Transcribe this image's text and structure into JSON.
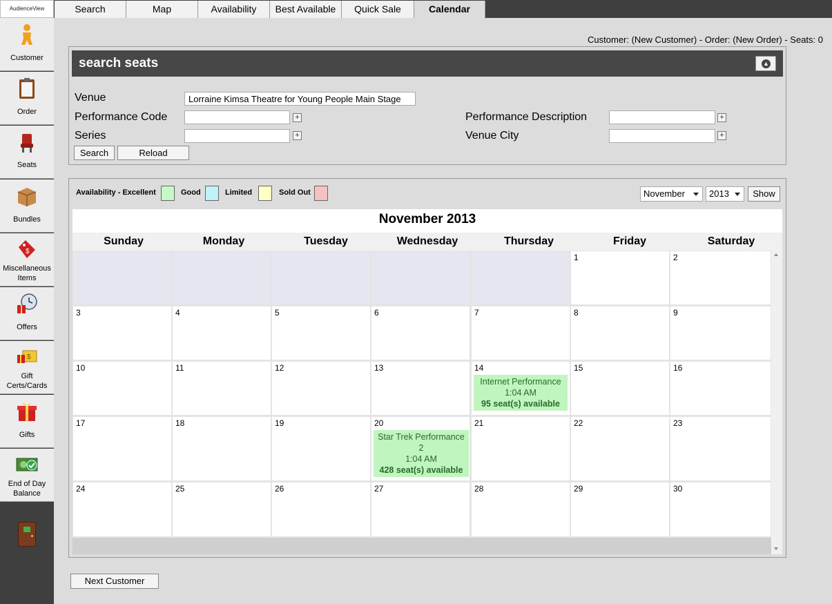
{
  "app": {
    "logo_text": "AudienceView"
  },
  "sidebar": {
    "items": [
      {
        "label": "Customer",
        "icon": "person-icon"
      },
      {
        "label": "Order",
        "icon": "clipboard-icon"
      },
      {
        "label": "Seats",
        "icon": "seat-icon"
      },
      {
        "label": "Bundles",
        "icon": "box-icon"
      },
      {
        "label": "Miscellaneous Items",
        "icon": "price-tag-icon"
      },
      {
        "label": "Offers",
        "icon": "clock-gift-icon"
      },
      {
        "label": "Gift Certs/Cards",
        "icon": "gift-card-icon"
      },
      {
        "label": "Gifts",
        "icon": "gift-icon"
      },
      {
        "label": "End of Day Balance",
        "icon": "money-check-icon"
      }
    ],
    "exit_icon": "exit-door-icon"
  },
  "tabs": [
    {
      "label": "Search"
    },
    {
      "label": "Map"
    },
    {
      "label": "Availability"
    },
    {
      "label": "Best Available"
    },
    {
      "label": "Quick Sale"
    },
    {
      "label": "Calendar"
    }
  ],
  "active_tab": "Calendar",
  "status_line": "Customer: (New Customer) - Order: (New Order) - Seats: 0",
  "search_seats": {
    "title": "search seats",
    "collapse_icon": "collapse-up-icon",
    "fields": {
      "venue_label": "Venue",
      "venue_value": "Lorraine Kimsa Theatre for Young People Main Stage",
      "performance_code_label": "Performance Code",
      "performance_code_value": "",
      "series_label": "Series",
      "series_value": "",
      "performance_description_label": "Performance Description",
      "performance_description_value": "",
      "venue_city_label": "Venue City",
      "venue_city_value": ""
    },
    "search_button": "Search",
    "reload_button": "Reload"
  },
  "calendar": {
    "legend": [
      {
        "label": "Availability - Excellent",
        "color": "#c6f7c6"
      },
      {
        "label": "Good",
        "color": "#bff3f7"
      },
      {
        "label": "Limited",
        "color": "#ffffc6"
      },
      {
        "label": "Sold Out",
        "color": "#f7c1c1"
      }
    ],
    "month_select": "November",
    "year_select": "2013",
    "show_button": "Show",
    "title": "November  2013",
    "day_names": [
      "Sunday",
      "Monday",
      "Tuesday",
      "Wednesday",
      "Thursday",
      "Friday",
      "Saturday"
    ],
    "weeks": [
      [
        "",
        "",
        "",
        "",
        "",
        "1",
        "2"
      ],
      [
        "3",
        "4",
        "5",
        "6",
        "7",
        "8",
        "9"
      ],
      [
        "10",
        "11",
        "12",
        "13",
        "14",
        "15",
        "16"
      ],
      [
        "17",
        "18",
        "19",
        "20",
        "21",
        "22",
        "23"
      ],
      [
        "24",
        "25",
        "26",
        "27",
        "28",
        "29",
        "30"
      ]
    ],
    "events": [
      {
        "day": "14",
        "name": "Internet Performance",
        "time": "1:04 AM",
        "availability": "95 seat(s) available"
      },
      {
        "day": "20",
        "name": "Star Trek Performance 2",
        "time": "1:04 AM",
        "availability": "428 seat(s) available"
      }
    ]
  },
  "next_customer_button": "Next Customer"
}
